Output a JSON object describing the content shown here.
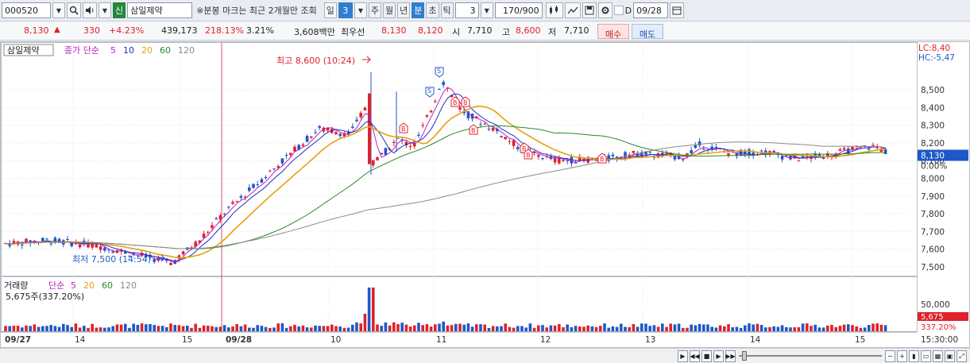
{
  "toolbar": {
    "code": "000520",
    "credit_badge": "신",
    "stock_name": "삼일제약",
    "notice": "※분봉 마크는 최근 2개월만 조회",
    "period_day": "일",
    "period_day_num": "3",
    "period_week": "주",
    "period_month": "월",
    "period_year": "년",
    "period_min": "분",
    "period_sec": "초",
    "period_tick": "틱",
    "interval": "3",
    "count": "170/900",
    "date_check": "D",
    "date": "09/28"
  },
  "info": {
    "price": "8,130",
    "change": "330",
    "rate": "+4.23%",
    "volume": "439,173",
    "vol_rate": "218.13%",
    "turnover": "3.21%",
    "amount": "3,608백만",
    "best_label": "최우선",
    "ask": "8,130",
    "bid": "8,120",
    "open_label": "시",
    "open": "7,710",
    "high_label": "고",
    "high": "8,600",
    "low_label": "저",
    "low": "7,710",
    "buy": "매수",
    "sell": "매도"
  },
  "legend": {
    "price_title": "삼일제약",
    "price_ma": "종가 단순",
    "ma": [
      "5",
      "10",
      "20",
      "60",
      "120"
    ],
    "vol_title": "거래량",
    "vol_ma": "단순",
    "vol_ma_list": [
      "5",
      "20",
      "60",
      "120"
    ],
    "vol_value": "5,675주(337.20%)"
  },
  "colors": {
    "up": "#e0212a",
    "down": "#1e58c8",
    "ma5": "#c020c0",
    "ma10": "#2030c0",
    "ma20": "#e8a010",
    "ma60": "#2a8a2a",
    "ma120": "#8a8a8a"
  },
  "annotations": {
    "high_label": "최고 8,600 (10:24)",
    "low_label": "최저 7,500 (14:54)",
    "lc": "LC:8,40",
    "hc": "HC:-5,47",
    "cur_price": "8,130",
    "cur_pct": "0.00%",
    "vol_cur": "5,675",
    "vol_pct": "337.20%",
    "time": "15:30:00"
  },
  "chart_data": {
    "type": "candlestick",
    "y_ticks": [
      "8,500",
      "8,400",
      "8,300",
      "8,200",
      "8,100",
      "8,000",
      "7,900",
      "7,800",
      "7,700",
      "7,600",
      "7,500"
    ],
    "ylim": [
      7450,
      8680
    ],
    "vol_ticks": [
      "50,000"
    ],
    "x_labels": [
      "09/27",
      "14",
      "15",
      "09/28",
      "10",
      "11",
      "12",
      "13",
      "14",
      "15"
    ],
    "high": 8600,
    "low": 7500,
    "last": 8130
  }
}
